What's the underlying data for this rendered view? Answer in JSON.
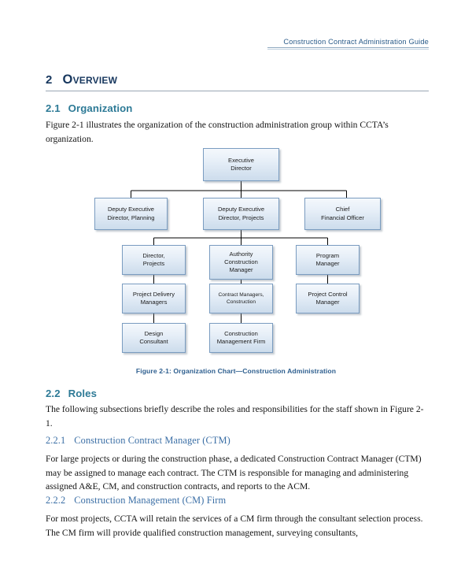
{
  "header": {
    "running_title": "Construction Contract Administration Guide"
  },
  "chapter": {
    "number": "2",
    "title": "Overview"
  },
  "sections": {
    "organization": {
      "number": "2.1",
      "title": "Organization",
      "paragraph": "Figure 2-1 illustrates the organization of the construction administration group within CCTA’s organization."
    },
    "roles": {
      "number": "2.2",
      "title": "Roles",
      "paragraph": "The following subsections briefly describe the roles and responsibilities for the staff shown in Figure 2-1."
    },
    "ctm": {
      "number": "2.2.1",
      "title": "Construction Contract Manager (CTM)",
      "paragraph": "For large projects or during the construction phase, a dedicated Construction Contract Manager (CTM) may be assigned to manage each contract. The CTM is responsible for managing and administering assigned A&E, CM, and construction contracts, and reports to the ACM."
    },
    "cm_firm": {
      "number": "2.2.2",
      "title": "Construction Management (CM) Firm",
      "paragraph": "For most projects, CCTA will retain the services of a CM firm through the consultant selection process. The CM firm will provide qualified construction management, surveying consultants,"
    }
  },
  "figure": {
    "caption": "Figure 2-1: Organization Chart—Construction Administration",
    "nodes": {
      "executive_director": "Executive\nDirector",
      "deputy_planning": "Deputy Executive\nDirector, Planning",
      "deputy_projects": "Deputy Executive\nDirector, Projects",
      "cfo": "Chief\nFinancial Officer",
      "director_projects": "Director,\nProjects",
      "acm": "Authority\nConstruction\nManager",
      "program_manager": "Program\nManager",
      "pdm": "Project Delivery\nManagers",
      "contract_managers": "Contract Managers,\nConstruction",
      "project_control": "Project Control\nManager",
      "design_consultant": "Design\nConsultant",
      "cm_firm": "Construction\nManagement Firm"
    }
  },
  "colors": {
    "heading_chapter": "#17375e",
    "heading_section": "#2d7a96",
    "heading_subsection": "#3a6ea5",
    "header_text": "#2b5c8a",
    "node_border": "#7a9cc0",
    "connector": "#000000",
    "caption": "#2e5f8f"
  }
}
